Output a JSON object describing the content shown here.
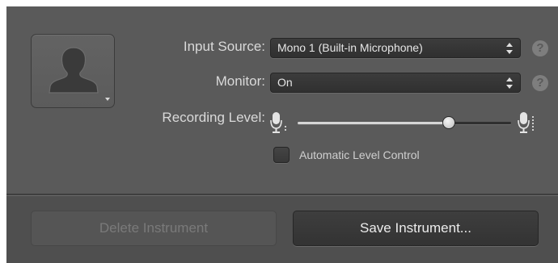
{
  "input_source": {
    "label": "Input Source:",
    "value": "Mono 1 (Built-in Microphone)",
    "help": "?"
  },
  "monitor": {
    "label": "Monitor:",
    "value": "On",
    "help": "?"
  },
  "recording_level": {
    "label": "Recording Level:",
    "level_percent": 71
  },
  "automatic_level_control": {
    "label": "Automatic Level Control",
    "checked": false
  },
  "buttons": {
    "delete_label": "Delete Instrument",
    "delete_enabled": false,
    "save_label": "Save Instrument..."
  },
  "icons": {
    "avatar": "person-silhouette-icon",
    "mic_low": "microphone-quiet-icon",
    "mic_high": "microphone-loud-icon"
  }
}
